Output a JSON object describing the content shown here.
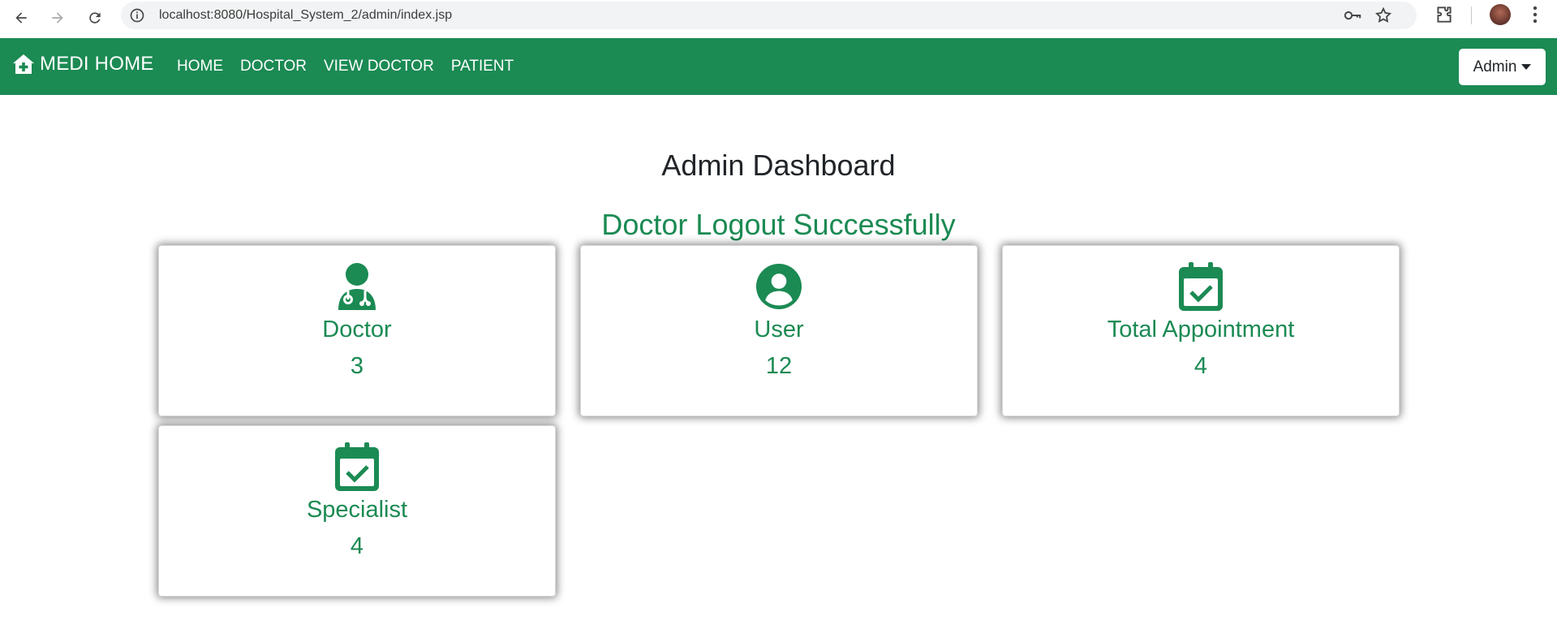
{
  "browser": {
    "url": "localhost:8080/Hospital_System_2/admin/index.jsp"
  },
  "navbar": {
    "brand": "MEDI HOME",
    "links": [
      "HOME",
      "DOCTOR",
      "VIEW DOCTOR",
      "PATIENT"
    ],
    "admin_label": "Admin",
    "color": "#1b8a53"
  },
  "main": {
    "title": "Admin Dashboard",
    "message": "Doctor Logout Successfully",
    "cards": [
      {
        "label": "Doctor",
        "value": "3",
        "icon": "doctor-icon"
      },
      {
        "label": "User",
        "value": "12",
        "icon": "user-circle-icon"
      },
      {
        "label": "Total Appointment",
        "value": "4",
        "icon": "calendar-check-icon"
      },
      {
        "label": "Specialist",
        "value": "4",
        "icon": "calendar-check-icon"
      }
    ]
  }
}
